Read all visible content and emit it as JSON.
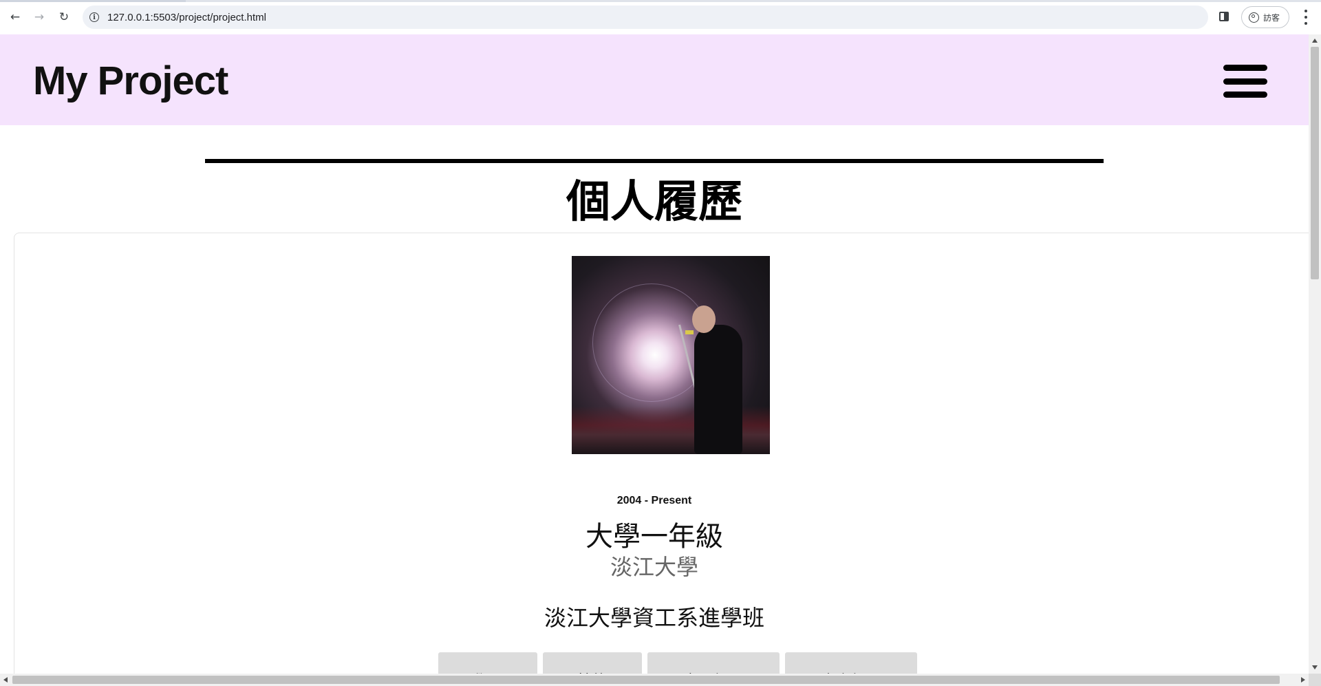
{
  "browser": {
    "url": "127.0.0.1:5503/project/project.html",
    "profile_label": "訪客",
    "icons": {
      "back": "arrow-left-icon",
      "forward": "arrow-right-icon",
      "reload": "reload-icon",
      "site_info": "info-icon",
      "side_panel": "side-panel-icon",
      "profile": "profile-icon",
      "menu": "kebab-menu-icon"
    }
  },
  "header": {
    "title": "My Project",
    "background_color": "#f5e3fd",
    "menu_icon": "hamburger-icon"
  },
  "section": {
    "title": "個人履歷"
  },
  "education": {
    "period": "2004 - Present",
    "degree": "大學一年級",
    "school": "淡江大學",
    "program": "淡江大學資工系進學班"
  },
  "tabs": [
    {
      "label": "學歷"
    },
    {
      "label": "技能"
    },
    {
      "label": "實習經歷"
    },
    {
      "label": "專案經歷"
    }
  ]
}
